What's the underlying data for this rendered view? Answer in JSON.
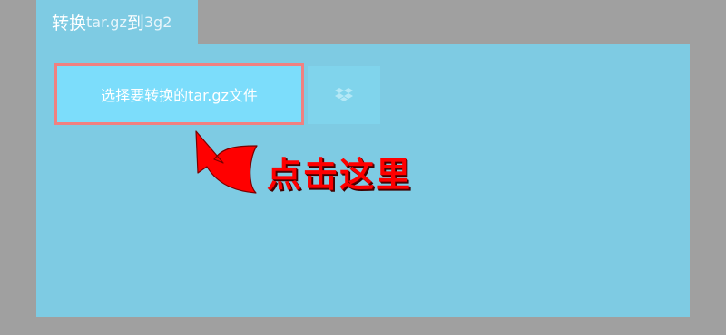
{
  "tab": {
    "part1": "转换",
    "part2": "tar.gz",
    "part3": "到",
    "part4": "3g2"
  },
  "upload": {
    "choose_label": "选择要转换的tar.gz文件",
    "dropbox_icon": "dropbox-icon"
  },
  "annotation": {
    "hint": "点击这里",
    "arrow_icon": "curved-arrow-icon"
  },
  "colors": {
    "background": "#a0a0a0",
    "panel": "#7ecbe3",
    "button": "#7cddfb",
    "button_border": "#f08080",
    "hint": "#ff0000"
  }
}
